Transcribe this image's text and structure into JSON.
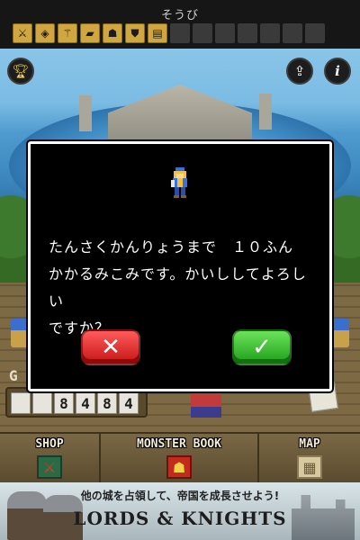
{
  "equipment": {
    "title": "そうび",
    "slots": [
      {
        "icon": "sword-icon",
        "filled": true
      },
      {
        "icon": "shield-icon",
        "filled": true
      },
      {
        "icon": "wand-icon",
        "filled": true
      },
      {
        "icon": "book-icon",
        "filled": true
      },
      {
        "icon": "helmet-icon",
        "filled": true
      },
      {
        "icon": "armor-icon",
        "filled": true
      },
      {
        "icon": "scroll-icon",
        "filled": true
      },
      {
        "icon": "",
        "filled": false
      },
      {
        "icon": "",
        "filled": false
      },
      {
        "icon": "",
        "filled": false
      },
      {
        "icon": "",
        "filled": false
      },
      {
        "icon": "",
        "filled": false
      },
      {
        "icon": "",
        "filled": false
      },
      {
        "icon": "",
        "filled": false
      }
    ]
  },
  "hud": {
    "trophy_icon": "trophy-icon",
    "share_icon": "share-icon",
    "info_icon": "info-icon",
    "gold_label": "G",
    "gold_digits": [
      "",
      "",
      "8",
      "4",
      "8",
      "4"
    ]
  },
  "dialog": {
    "message_line1": "たんさくかんりょうまで　１０ふん",
    "message_line2": "かかるみこみです。かいししてよろしい",
    "message_line3": "ですか？",
    "cancel_symbol": "✕",
    "confirm_symbol": "✓"
  },
  "menu": {
    "items": [
      {
        "label": "SHOP",
        "icon": "shop-icon"
      },
      {
        "label": "MONSTER BOOK",
        "icon": "monster-book-icon"
      },
      {
        "label": "MAP",
        "icon": "map-icon"
      }
    ]
  },
  "ad": {
    "tagline": "他の城を占領して、帝国を成長させよう!",
    "title": "LORDS & KNIGHTS"
  },
  "colors": {
    "dialog_border": "#ffffff",
    "cancel_button": "#e02a2a",
    "confirm_button": "#2fb82a",
    "slot_filled": "#d0a640"
  }
}
